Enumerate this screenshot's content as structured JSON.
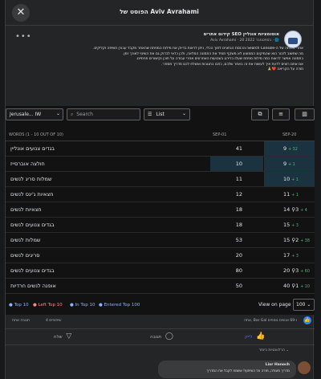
{
  "header": {
    "title": "הפוסט של Aviv Avrahami",
    "close_glyph": "✕"
  },
  "post": {
    "group_name": "קידום אתרים SEO אוטומציות אונליין",
    "meta": "Aviv Avrahami · 20 בספטמבר 2022 · 🌐",
    "menu_glyph": "•••",
    "body": "אחרי פתיחה של ה-Search Console והכנסת הנתונים לתוך הכלי, ניתן לראות בדיוק את מילות המפתח שהאתר מקבל עבורן חשיפה וקליקים.\nמה שחשוב לזכור הוא שהמיקום הממוצע לא משקף תמיד את התמונה המלאה, ולכן כדאי לבדוק גם את השינוי לאורך זמן.\nבתמונה אפשר לראות כמה מילות מפתח שעלו בדירוג בשבועות האחרונים אחרי עבודה על תוכן וקישורים פנימיים.\nאם אתם רוצים לדעת איך לעשות את זה באתר שלכם, כתבו בתגובות ואשלח לכם מדריך מסודר.\nתודה על הקריאה ❤️🙏"
  },
  "toolbar": {
    "location_select": "Jerusale... IW",
    "search_placeholder": "Search",
    "view_select": "List"
  },
  "table": {
    "kw_header": "WORDS (1 - 10 OUT OF 10)",
    "col1_header": "SEP-01",
    "col2_header": "SEP-20",
    "rows": [
      {
        "kw": "בגדים צנועים אונליין",
        "v1": "41",
        "v2": "9",
        "chg": "+ 32",
        "hl1": false,
        "hl2": true
      },
      {
        "kw": "חולצה אוברסייז",
        "v1": "10",
        "v2": "9",
        "chg": "+ 1",
        "hl1": true,
        "hl2": true
      },
      {
        "kw": "שמלות סריג לנשים",
        "v1": "11",
        "v2": "10",
        "chg": "+ 1",
        "hl1": false,
        "hl2": true
      },
      {
        "kw": "חצאיות ג'ינס לנשים",
        "v1": "12",
        "v2": "11",
        "chg": "+ 1",
        "hl1": false,
        "hl2": false
      },
      {
        "kw": "חצאיות לנשים",
        "v1": "18",
        "v2": "14 ⚲3",
        "chg": "+ 4",
        "hl1": false,
        "hl2": false
      },
      {
        "kw": "בגדים צנועים לנשים",
        "v1": "18",
        "v2": "15",
        "chg": "+ 3",
        "hl1": false,
        "hl2": false
      },
      {
        "kw": "שמלות לנשים",
        "v1": "53",
        "v2": "15 ⚲2",
        "chg": "+ 38",
        "hl1": false,
        "hl2": false
      },
      {
        "kw": "סריגים לנשים",
        "v1": "20",
        "v2": "17",
        "chg": "+ 3",
        "hl1": false,
        "hl2": false
      },
      {
        "kw": "בגדים צנועים לנשים",
        "v1": "80",
        "v2": "20 ⚲3",
        "chg": "+ 60",
        "hl1": false,
        "hl2": false
      },
      {
        "kw": "אופנה לנשים חרדיות",
        "v1": "50",
        "v2": "40 ⚲1",
        "chg": "+ 10",
        "hl1": false,
        "hl2": false
      }
    ]
  },
  "footer": {
    "top10": "Top 10",
    "left_top10": "Left Top 10",
    "in_top10": "In Top 10",
    "entered_top100": "Entered Top 100",
    "view_on": "View on page",
    "per_page": "100"
  },
  "reactions": {
    "summary": "אתה, Bar Gal ו-69 אנשים נוספים",
    "shares": "4 שיתופים",
    "comments_count": "תגובה אחת"
  },
  "actions": {
    "like": "לייק",
    "comment": "תגובה",
    "share": "שלח"
  },
  "comments": {
    "sort_label": "הרלוונטיות ביותר",
    "author": "Lior Hanoch",
    "text": "מדריך מעולה, תודה על השיתוף! אשמח לקבל את המדריך"
  },
  "colors": {
    "accent": "#2d88ff",
    "positive": "#4dbd7a",
    "highlight": "#1b3340"
  }
}
